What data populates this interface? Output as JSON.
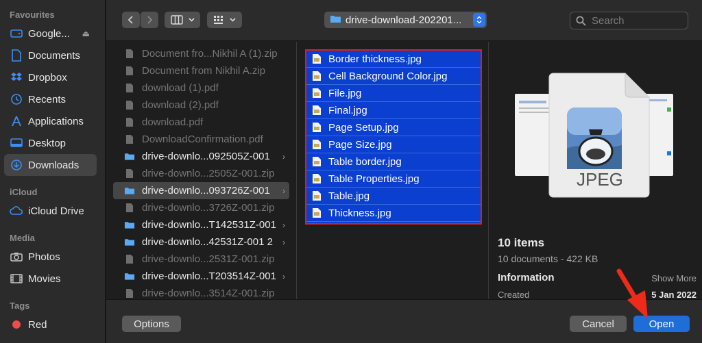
{
  "sidebar": {
    "sections": [
      {
        "title": "Favourites"
      },
      {
        "title": "iCloud"
      },
      {
        "title": "Media"
      },
      {
        "title": "Tags"
      }
    ],
    "favourites": [
      {
        "label": "Google...",
        "icon": "drive-icon",
        "eject": true
      },
      {
        "label": "Documents",
        "icon": "document-icon"
      },
      {
        "label": "Dropbox",
        "icon": "dropbox-icon"
      },
      {
        "label": "Recents",
        "icon": "clock-icon"
      },
      {
        "label": "Applications",
        "icon": "applications-icon"
      },
      {
        "label": "Desktop",
        "icon": "desktop-icon"
      },
      {
        "label": "Downloads",
        "icon": "downloads-icon",
        "active": true
      }
    ],
    "icloud": [
      {
        "label": "iCloud Drive",
        "icon": "cloud-icon"
      }
    ],
    "media": [
      {
        "label": "Photos",
        "icon": "camera-icon"
      },
      {
        "label": "Movies",
        "icon": "film-icon"
      }
    ],
    "tags": [
      {
        "label": "Red",
        "color": "#ef4c4c"
      }
    ]
  },
  "toolbar": {
    "path": "drive-download-202201...",
    "search_placeholder": "Search"
  },
  "column1": [
    {
      "name": "Document fro...Nikhil A (1).zip",
      "type": "file",
      "dim": true
    },
    {
      "name": "Document from Nikhil A.zip",
      "type": "file",
      "dim": true
    },
    {
      "name": "download (1).pdf",
      "type": "file",
      "dim": true
    },
    {
      "name": "download (2).pdf",
      "type": "file",
      "dim": true
    },
    {
      "name": "download.pdf",
      "type": "file",
      "dim": true
    },
    {
      "name": "DownloadConfirmation.pdf",
      "type": "file",
      "dim": true
    },
    {
      "name": "drive-downlo...092505Z-001",
      "type": "folder",
      "chevron": true
    },
    {
      "name": "drive-downlo...2505Z-001.zip",
      "type": "file",
      "dim": true
    },
    {
      "name": "drive-downlo...093726Z-001",
      "type": "folder",
      "chevron": true,
      "selected": true
    },
    {
      "name": "drive-downlo...3726Z-001.zip",
      "type": "file",
      "dim": true
    },
    {
      "name": "drive-downlo...T142531Z-001",
      "type": "folder",
      "chevron": true
    },
    {
      "name": "drive-downlo...42531Z-001 2",
      "type": "folder",
      "chevron": true
    },
    {
      "name": "drive-downlo...2531Z-001.zip",
      "type": "file",
      "dim": true
    },
    {
      "name": "drive-downlo...T203514Z-001",
      "type": "folder",
      "chevron": true
    },
    {
      "name": "drive-downlo...3514Z-001.zip",
      "type": "file",
      "dim": true
    }
  ],
  "column2": [
    "Border thickness.jpg",
    "Cell Background Color.jpg",
    "File.jpg",
    "Final.jpg",
    "Page Setup.jpg",
    "Page Size.jpg",
    "Table border.jpg",
    "Table Properties.jpg",
    "Table.jpg",
    "Thickness.jpg"
  ],
  "preview": {
    "badge": "JPEG",
    "items": "10 items",
    "summary": "10 documents - 422 KB",
    "info_title": "Information",
    "show_more": "Show More",
    "created_label": "Created",
    "created_value": "5 Jan 2022"
  },
  "buttons": {
    "options": "Options",
    "cancel": "Cancel",
    "open": "Open"
  },
  "colors": {
    "accent": "#1f6ed8",
    "selection_fill": "#0a3fcf",
    "annotation_red": "#d82020"
  }
}
